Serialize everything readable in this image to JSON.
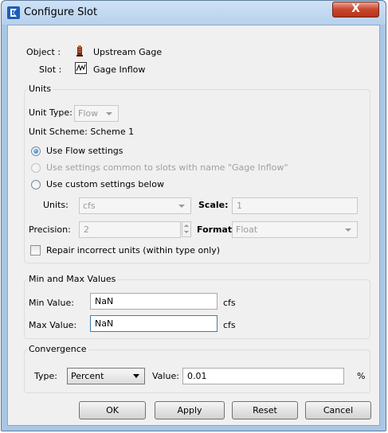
{
  "window": {
    "title": "Configure Slot",
    "close_glyph": "X"
  },
  "object": {
    "label": "Object :",
    "value": "Upstream Gage",
    "icon": "gage-object-icon"
  },
  "slot": {
    "label": "Slot :",
    "value": "Gage Inflow",
    "icon": "series-slot-icon"
  },
  "units": {
    "group_title": "Units",
    "unit_type_label": "Unit Type:",
    "unit_type_value": "Flow",
    "unit_scheme": "Unit Scheme: Scheme 1",
    "radio_flow": "Use Flow settings",
    "radio_common": "Use settings common to slots with name \"Gage Inflow\"",
    "radio_custom": "Use custom settings below",
    "units_label": "Units:",
    "units_value": "cfs",
    "scale_label": "Scale:",
    "scale_value": "1",
    "precision_label": "Precision:",
    "precision_value": "2",
    "format_label": "Format",
    "format_value": "Float",
    "repair_label": "Repair incorrect units (within type only)"
  },
  "minmax": {
    "group_title": "Min and Max Values",
    "min_label": "Min Value:",
    "min_value": "NaN",
    "min_unit": "cfs",
    "max_label": "Max Value:",
    "max_value": "NaN",
    "max_unit": "cfs"
  },
  "convergence": {
    "group_title": "Convergence",
    "type_label": "Type:",
    "type_value": "Percent",
    "value_label": "Value:",
    "value": "0.01",
    "unit": "%"
  },
  "buttons": {
    "ok": "OK",
    "apply": "Apply",
    "reset": "Reset",
    "cancel": "Cancel"
  },
  "colors": {
    "title_bar": "#b6d0ec",
    "close": "#c9452c",
    "focus": "#3c7fb1"
  }
}
